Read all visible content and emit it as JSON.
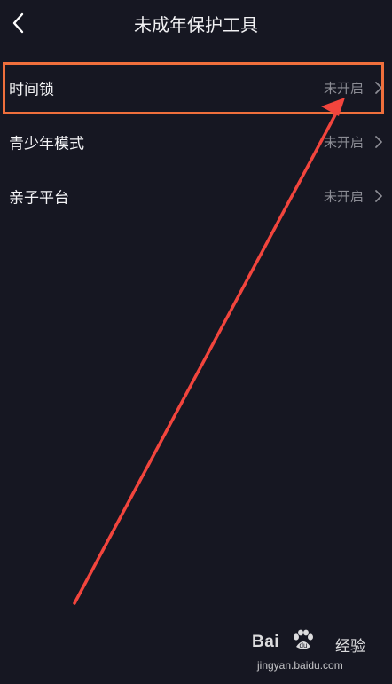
{
  "header": {
    "title": "未成年保护工具",
    "back_icon": "chevron-left-icon"
  },
  "settings": {
    "items": [
      {
        "label": "时间锁",
        "status": "未开启"
      },
      {
        "label": "青少年模式",
        "status": "未开启"
      },
      {
        "label": "亲子平台",
        "status": "未开启"
      }
    ]
  },
  "annotation": {
    "box_color": "#ef6f3c",
    "arrow_color": "#f2453d"
  },
  "watermark": {
    "brand_left": "Bai",
    "brand_right": "经验",
    "url": "jingyan.baidu.com"
  },
  "colors": {
    "background": "#161722",
    "text_primary": "#f3f3f5",
    "text_secondary": "#8c8d95"
  }
}
